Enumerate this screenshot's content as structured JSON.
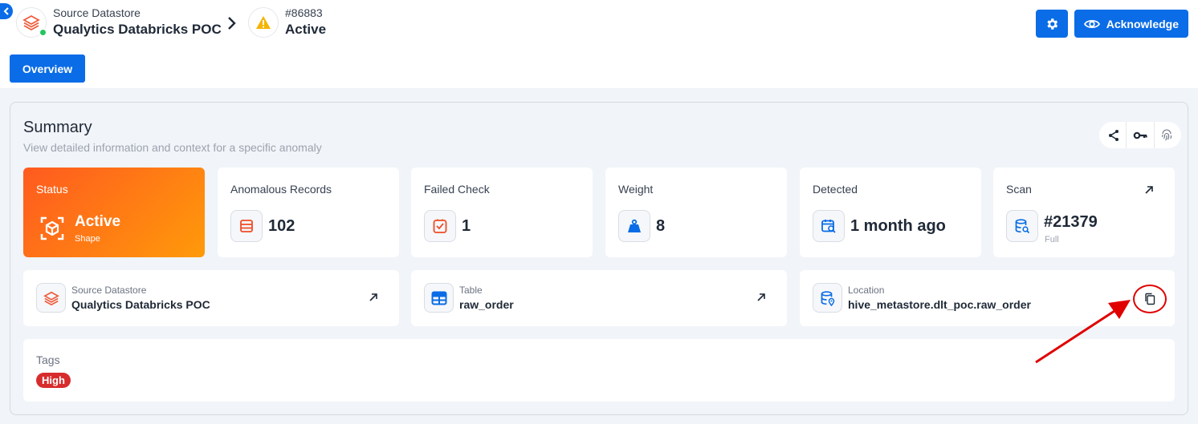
{
  "breadcrumb": {
    "datastore_caption": "Source Datastore",
    "datastore_name": "Qualytics Databricks POC",
    "anomaly_id": "#86883",
    "anomaly_status": "Active"
  },
  "actions": {
    "acknowledge_label": "Acknowledge",
    "settings_icon": "gear-icon"
  },
  "tabs": [
    {
      "label": "Overview",
      "active": true
    }
  ],
  "summary": {
    "title": "Summary",
    "subtitle": "View detailed information and context for a specific anomaly",
    "toolbar_icons": [
      "share-icon",
      "key-icon",
      "fingerprint-icon"
    ],
    "cards": {
      "status": {
        "label": "Status",
        "value": "Active",
        "sub": "Shape"
      },
      "anomalous_records": {
        "label": "Anomalous Records",
        "value": "102"
      },
      "failed_check": {
        "label": "Failed Check",
        "value": "1"
      },
      "weight": {
        "label": "Weight",
        "value": "8"
      },
      "detected": {
        "label": "Detected",
        "value": "1 month ago"
      },
      "scan": {
        "label": "Scan",
        "value": "#21379",
        "sub": "Full"
      }
    },
    "details": {
      "source_datastore": {
        "label": "Source Datastore",
        "value": "Qualytics Databricks POC"
      },
      "table": {
        "label": "Table",
        "value": "raw_order"
      },
      "location": {
        "label": "Location",
        "value": "hive_metastore.dlt_poc.raw_order"
      }
    },
    "tags": {
      "label": "Tags",
      "items": [
        "High"
      ]
    }
  },
  "colors": {
    "primary": "#0a6ce6",
    "status_gradient_start": "#ff5a1f",
    "status_gradient_end": "#ff9a0a",
    "tag_high": "#d82c2c",
    "annotation": "#e00000",
    "page_bg": "#f1f4f8"
  }
}
